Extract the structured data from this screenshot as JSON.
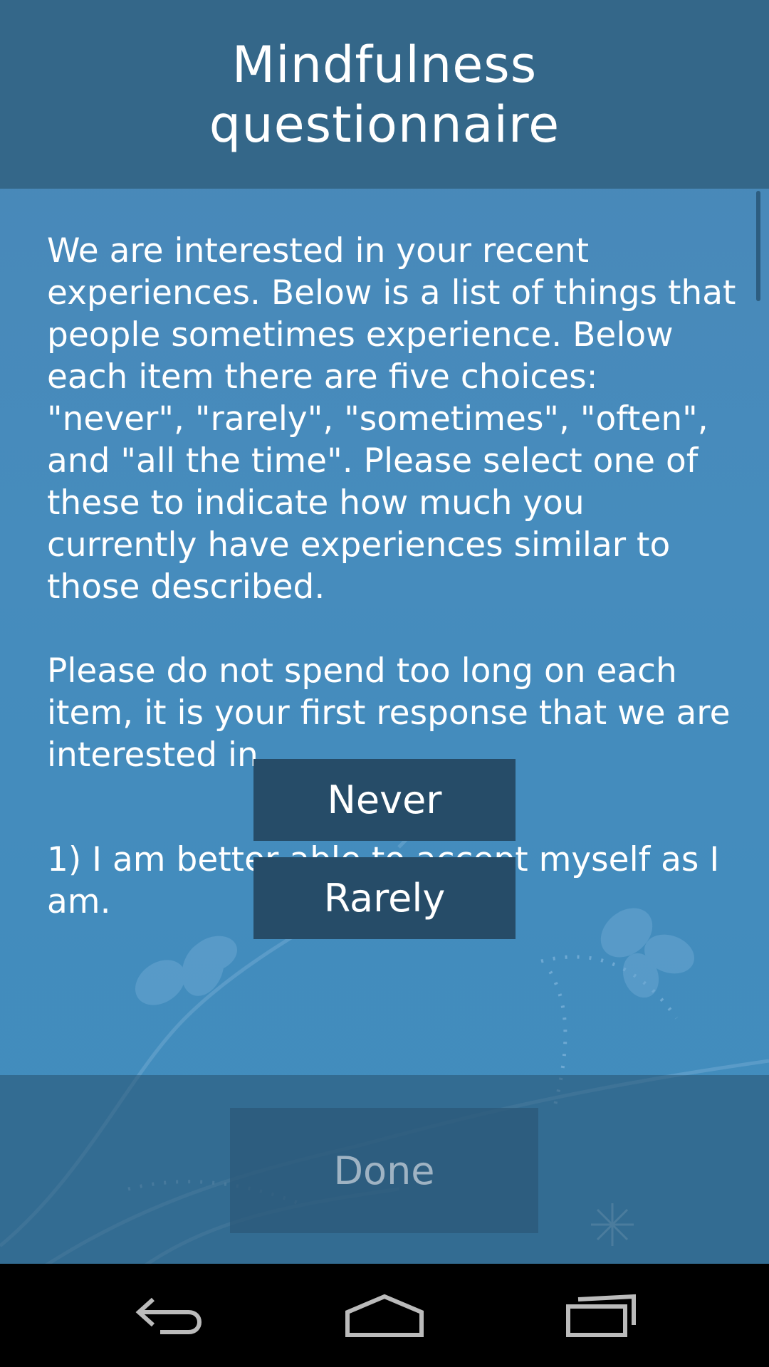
{
  "header": {
    "title": "Mindfulness\nquestionnaire"
  },
  "intro": {
    "text": "We are interested in your recent experiences. Below is a list of things that people sometimes experience. Below each item there are five choices: \"never\", \"rarely\", \"sometimes\", \"often\", and \"all the time\". Please select one of these to indicate how much you currently have experiences similar to those described.\n\nPlease do not spend too long on each item, it is your first response that we are interested in."
  },
  "question": {
    "text": "1) I am better able to accept myself as I am."
  },
  "answers": [
    {
      "label": "Never"
    },
    {
      "label": "Rarely"
    }
  ],
  "footer": {
    "done_label": "Done"
  },
  "navbar": {
    "back": "back-icon",
    "home": "home-icon",
    "recents": "recents-icon"
  },
  "colors": {
    "header": "#346789",
    "button": "#264c68",
    "background": "#468cbd"
  }
}
